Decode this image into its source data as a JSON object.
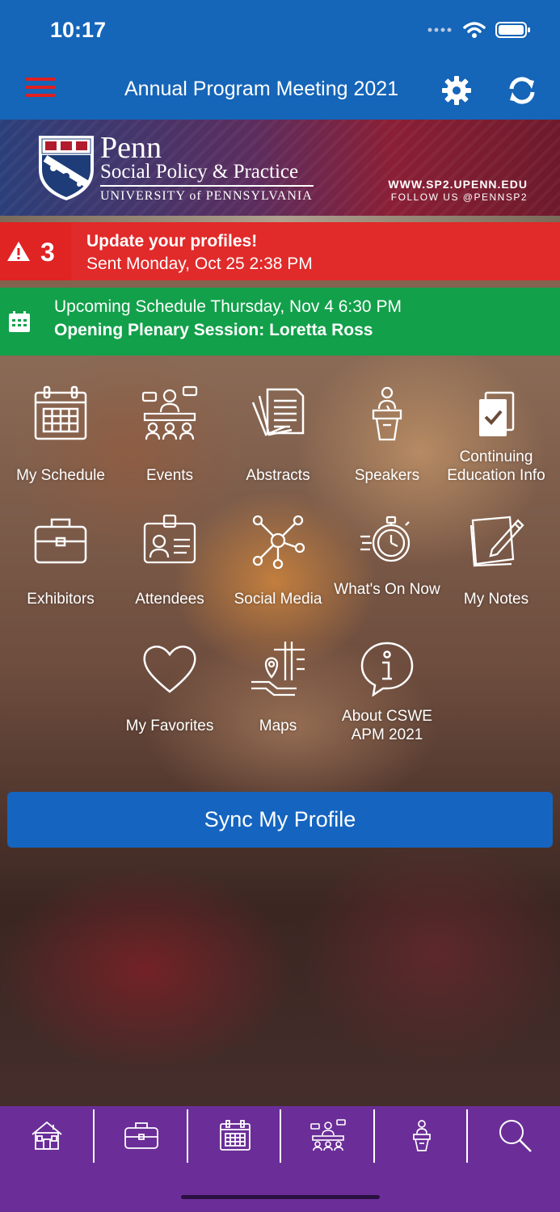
{
  "status_bar": {
    "time": "10:17"
  },
  "header": {
    "title": "Annual Program Meeting 2021"
  },
  "banner": {
    "penn": "Penn",
    "school": "Social Policy & Practice",
    "university": "UNIVERSITY of PENNSYLVANIA",
    "url": "WWW.SP2.UPENN.EDU",
    "follow": "FOLLOW US @PENNSP2"
  },
  "alert": {
    "count": "3",
    "title": "Update your profiles!",
    "sent": "Sent Monday, Oct 25 2:38 PM"
  },
  "upcoming": {
    "line1": "Upcoming Schedule Thursday, Nov 4 6:30 PM",
    "line2": "Opening Plenary Session: Loretta Ross"
  },
  "tiles": [
    {
      "label": "My Schedule",
      "icon": "calendar-icon"
    },
    {
      "label": "Events",
      "icon": "meeting-icon"
    },
    {
      "label": "Abstracts",
      "icon": "documents-icon"
    },
    {
      "label": "Speakers",
      "icon": "podium-speaker-icon"
    },
    {
      "label": "Continuing Education Info",
      "icon": "checked-document-icon"
    },
    {
      "label": "Exhibitors",
      "icon": "briefcase-icon"
    },
    {
      "label": "Attendees",
      "icon": "id-badge-icon"
    },
    {
      "label": "Social Media",
      "icon": "network-icon"
    },
    {
      "label": "What's On Now",
      "icon": "stopwatch-icon"
    },
    {
      "label": "My Notes",
      "icon": "notepad-pencil-icon"
    },
    {
      "label": "My Favorites",
      "icon": "heart-icon"
    },
    {
      "label": "Maps",
      "icon": "map-pin-icon"
    },
    {
      "label": "About CSWE APM 2021",
      "icon": "info-bubble-icon"
    }
  ],
  "sync_button": {
    "label": "Sync My Profile"
  },
  "tabbar": {
    "items": [
      {
        "icon": "home-icon"
      },
      {
        "icon": "briefcase-icon"
      },
      {
        "icon": "calendar-icon"
      },
      {
        "icon": "meeting-icon"
      },
      {
        "icon": "podium-speaker-icon"
      },
      {
        "icon": "search-icon"
      }
    ]
  },
  "colors": {
    "header_blue": "#1565b8",
    "alert_red": "#e02323",
    "upcoming_green": "#12a04a",
    "sync_blue": "#1565c0",
    "tabbar_purple": "#6b2e98",
    "menu_red": "#e02020"
  }
}
